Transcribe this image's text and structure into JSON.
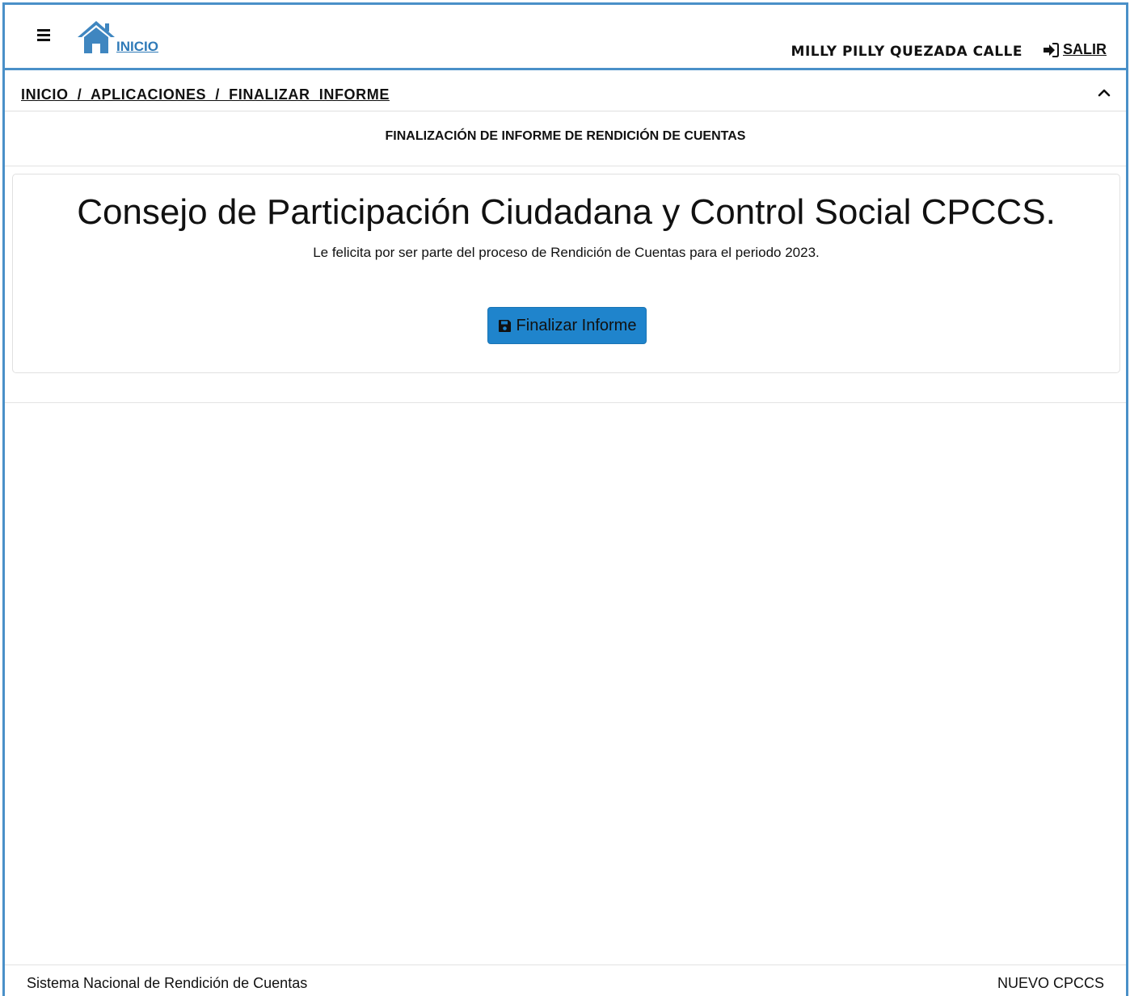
{
  "header": {
    "home_label": "INICIO",
    "user_name": "MILLY PILLY QUEZADA CALLE",
    "logout_label": "SALIR"
  },
  "breadcrumb": {
    "text": "INICIO  /  APLICACIONES  /  FINALIZAR  INFORME"
  },
  "section": {
    "title": "FINALIZACIÓN DE INFORME DE RENDICIÓN DE CUENTAS"
  },
  "card": {
    "title": "Consejo de Participación Ciudadana y Control Social CPCCS.",
    "subtitle": "Le felicita por ser parte del proceso de Rendición de Cuentas para el periodo 2023.",
    "button_label": "Finalizar Informe"
  },
  "footer": {
    "left": "Sistema Nacional de Rendición de Cuentas",
    "right": "NUEVO CPCCS"
  },
  "colors": {
    "frame": "#4a90c8",
    "home_icon": "#3f86c0",
    "primary_button": "#1f84cc"
  },
  "icons": {
    "menu": "hamburger-icon",
    "home": "home-icon",
    "logout": "sign-in-icon",
    "collapse": "chevron-up-icon",
    "save": "floppy-disk-icon"
  }
}
